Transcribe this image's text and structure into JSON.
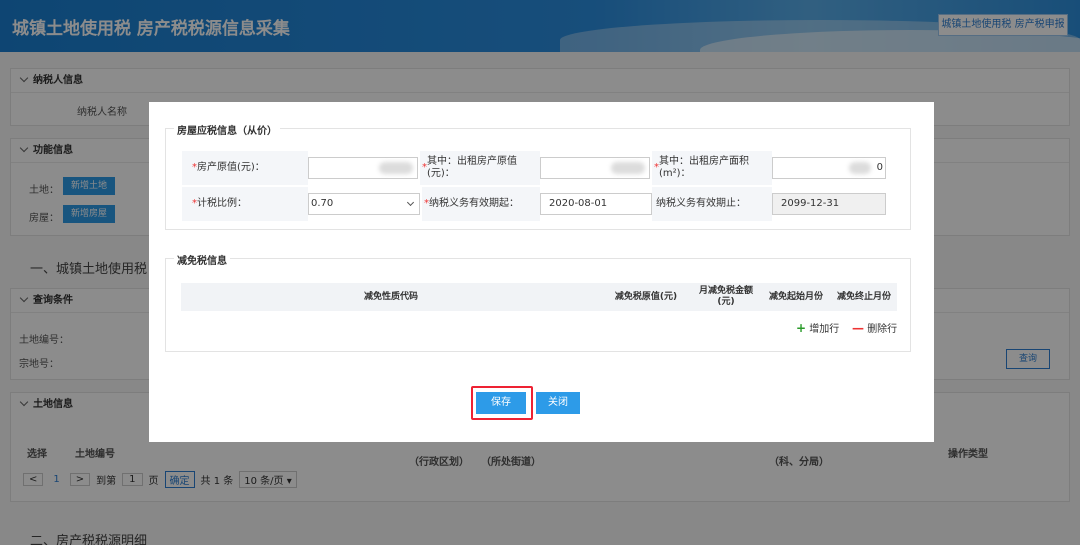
{
  "header": {
    "title": "城镇土地使用税 房产税税源信息采集",
    "right_button": "城镇土地使用税 房产税申报"
  },
  "background": {
    "taxpayer_section": "纳税人信息",
    "taxpayer_name_label": "纳税人名称",
    "function_section": "功能信息",
    "land_label": "土地：",
    "land_btn": "新增土地",
    "house_label": "房屋：",
    "house_btn": "新增房屋",
    "section_one": "一、城镇土地使用税",
    "query_section": "查询条件",
    "land_no_label": "土地编号：",
    "parcel_no_label": "宗地号：",
    "query_btn": "查询",
    "land_info_section": "土地信息",
    "table_headers": [
      "选择",
      "土地编号",
      "（行政区划）",
      "（所处街道）",
      "（科、分局）",
      "操作类型"
    ],
    "pager": {
      "prev": "<",
      "page": "1",
      "next": ">",
      "goto_label": "到第",
      "goto_value": "1",
      "page_unit": "页",
      "confirm": "确定",
      "total": "共 1 条",
      "per_page": "10 条/页 ▾"
    },
    "section_two": "二、房产税税源明细"
  },
  "modal": {
    "house_section": "房屋应税信息（从价）",
    "original_value_label": "房产原值(元)：",
    "rent_original_label": "其中：出租房产原值(元)：",
    "rent_area_label": "其中：出租房产面积(m²)：",
    "rent_area_suffix": "0",
    "ratio_label": "计税比例：",
    "ratio_value": "0.70",
    "start_label": "纳税义务有效期起：",
    "start_value": "2020-08-01",
    "end_label": "纳税义务有效期止：",
    "end_value": "2099-12-31",
    "relief_section": "减免税信息",
    "relief_headers": [
      "减免性质代码",
      "减免税原值(元)",
      "月减免税金额(元)",
      "减免起始月份",
      "减免终止月份"
    ],
    "add_row": "增加行",
    "delete_row": "删除行",
    "save": "保存",
    "close": "关闭"
  },
  "colors": {
    "accent": "#2d9be8",
    "required": "#e33333",
    "highlight_border": "#e22233"
  }
}
